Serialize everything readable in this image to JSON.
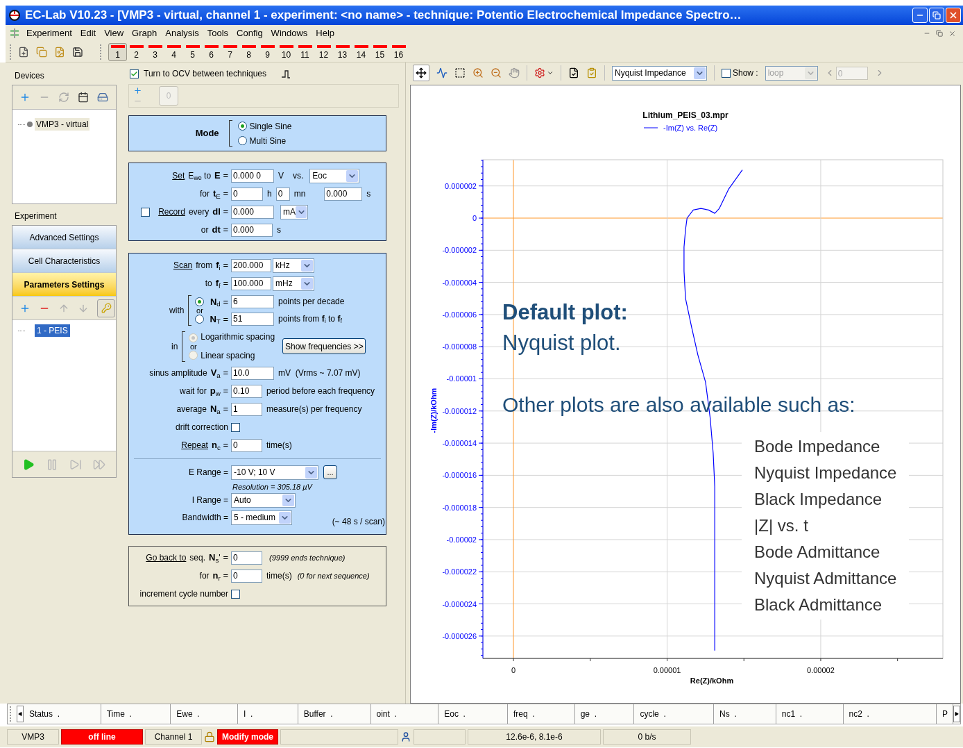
{
  "window": {
    "title": "EC-Lab V10.23 - [VMP3 - virtual, channel 1 - experiment: <no name> - technique: Potentio Electrochemical Impedance Spectro…"
  },
  "menu": [
    {
      "label": "Experiment"
    },
    {
      "label": "Edit"
    },
    {
      "label": "View"
    },
    {
      "label": "Graph"
    },
    {
      "label": "Analysis"
    },
    {
      "label": "Tools"
    },
    {
      "label": "Config"
    },
    {
      "label": "Windows"
    },
    {
      "label": "Help"
    }
  ],
  "channels": [
    {
      "label": "1",
      "selected": true
    },
    {
      "label": "2",
      "selected": false
    },
    {
      "label": "3",
      "selected": false
    },
    {
      "label": "4",
      "selected": false
    },
    {
      "label": "5",
      "selected": false
    },
    {
      "label": "6",
      "selected": false
    },
    {
      "label": "7",
      "selected": false
    },
    {
      "label": "8",
      "selected": false
    },
    {
      "label": "9",
      "selected": false
    },
    {
      "label": "10",
      "selected": false
    },
    {
      "label": "11",
      "selected": false
    },
    {
      "label": "12",
      "selected": false
    },
    {
      "label": "13",
      "selected": false
    },
    {
      "label": "14",
      "selected": false
    },
    {
      "label": "15",
      "selected": false
    },
    {
      "label": "16",
      "selected": false
    }
  ],
  "devices": {
    "title": "Devices",
    "items": [
      {
        "label": "VMP3 - virtual"
      }
    ]
  },
  "experiment": {
    "title": "Experiment",
    "sections": [
      {
        "label": "Advanced Settings",
        "selected": false
      },
      {
        "label": "Cell Characteristics",
        "selected": false
      },
      {
        "label": "Parameters Settings",
        "selected": true
      }
    ],
    "techniques": [
      {
        "label": "1 - PEIS",
        "selected": true
      }
    ]
  },
  "ocv": {
    "label": "Turn to OCV between techniques",
    "checked": true
  },
  "sequences": [
    {
      "label": "0"
    }
  ],
  "mode": {
    "label": "Mode",
    "options": [
      {
        "label": "Single Sine",
        "selected": true
      },
      {
        "label": "Multi Sine",
        "selected": false
      }
    ]
  },
  "potential": {
    "set": {
      "link": "Set",
      "label": "E$_{we}$ to",
      "symbol": "**E** =",
      "value": "0.000 0",
      "unit": "V",
      "vs": "vs.",
      "reference": "Eoc"
    },
    "duration": {
      "label": "for",
      "symbol": "**t**$_{E}$ =",
      "fields": [
        {
          "value": "0",
          "unit": "h"
        },
        {
          "value": "0",
          "unit": "mn"
        },
        {
          "value": "0.000",
          "unit": "s"
        }
      ]
    },
    "record": {
      "checked": false,
      "link": "Record",
      "label": "every",
      "symbol": "**dI** =",
      "value": "0.000",
      "unit": "mA"
    },
    "record_dt": {
      "label": "or",
      "symbol": "**dt** =",
      "value": "0.000",
      "unit": "s"
    }
  },
  "scan": {
    "from": {
      "link": "Scan",
      "label": "from",
      "symbol": "**f**$_{i}$ =",
      "value": "200.000",
      "unit": "kHz"
    },
    "to": {
      "label": "to",
      "symbol": "**f**$_{f}$ =",
      "value": "100.000",
      "unit": "mHz"
    },
    "points": {
      "label": "with",
      "or": "or",
      "options": [
        {
          "symbol": "**N**$_{d}$ =",
          "value": "6",
          "note": "points per decade",
          "selected": true
        },
        {
          "symbol": "**N**$_{T}$ =",
          "value": "51",
          "note": "points from **f**$_{i}$  to  **f**$_{f}$",
          "selected": false
        }
      ]
    },
    "spacing": {
      "label": "in",
      "or": "or",
      "disabled": true,
      "options": [
        {
          "label": "Logarithmic spacing",
          "selected": true
        },
        {
          "label": "Linear spacing",
          "selected": false
        }
      ],
      "button": "Show frequencies >>"
    },
    "rows": [
      {
        "kind": "field",
        "label": "sinus amplitude",
        "symbol": "**V**$_{a}$ =",
        "value": "10.0",
        "note": "mV  (Vrms ~ 7.07 mV)"
      },
      {
        "kind": "field",
        "label": "wait for",
        "symbol": "**p**$_{w}$ =",
        "value": "0.10",
        "note": "period before each frequency"
      },
      {
        "kind": "field",
        "label": "average",
        "symbol": "**N**$_{a}$ =",
        "value": "1",
        "note": "measure(s) per frequency"
      },
      {
        "kind": "checkbox",
        "label": "drift correction",
        "checked": false
      },
      {
        "kind": "field",
        "link": "Repeat",
        "symbol": "**n**$_{c}$ =",
        "value": "0",
        "note": "time(s)"
      }
    ],
    "e_range": {
      "label": "E Range =",
      "value": "-10 V; 10 V",
      "button": "...",
      "resolution": "Resolution = 305.18 µV"
    },
    "i_range": {
      "label": "I Range =",
      "value": "Auto"
    },
    "bandwidth": {
      "label": "Bandwidth =",
      "value": "5 - medium"
    },
    "estimate": "(~ 48 s / scan)"
  },
  "goto": {
    "link": "Go back to",
    "label": "seq.",
    "symbol": "**N**$_{s}$' =",
    "value": "0",
    "note": "(9999 ends technique)",
    "repeat": {
      "label": "for",
      "symbol": "**n**$_{r}$ =",
      "value": "0",
      "unit": "time(s)",
      "note": "(0 for next sequence)"
    },
    "increment": {
      "label": "increment cycle number",
      "checked": false
    }
  },
  "plot": {
    "selector": "Nyquist Impedance",
    "show": {
      "label": "Show :",
      "checked": false
    },
    "loop": "loop",
    "loop_index": "0",
    "chart_data": {
      "type": "line",
      "title": "Lithium_PEIS_03.mpr",
      "xlabel": "Re(Z)/kOhm",
      "ylabel": "-Im(Z)/kOhm",
      "grid": true,
      "x": [
        1.49e-05,
        1.4e-05,
        1.34e-05,
        1.31e-05,
        1.27e-05,
        1.22e-05,
        1.17e-05,
        1.13e-05,
        1.12e-05,
        1.11e-05,
        1.11e-05,
        1.12e-05,
        1.16e-05,
        1.2e-05,
        1.25e-05,
        1.28e-05,
        1.3e-05,
        1.31e-05,
        1.31e-05,
        1.31e-05,
        1.31e-05
      ],
      "series": [
        {
          "name": "-Im(Z) vs. Re(Z)",
          "color": "#0000ff",
          "values": [
            3e-06,
            1.8e-06,
            6e-07,
            3e-07,
            5e-07,
            6e-07,
            5e-07,
            0.0,
            -7e-07,
            -1.8e-06,
            -3.3e-06,
            -5e-06,
            -6.8e-06,
            -8.5e-06,
            -1.02e-05,
            -1.24e-05,
            -1.46e-05,
            -1.67e-05,
            -2.02e-05,
            -2.36e-05,
            -2.69e-05
          ]
        }
      ],
      "xlim": [
        -1.99e-06,
        2.795e-05
      ],
      "ylim": [
        -2.739e-05,
        3.63e-06
      ],
      "xticks": [
        {
          "value": 0,
          "label": "0"
        },
        {
          "value": 1e-05,
          "label": "0.00001"
        },
        {
          "value": 2e-05,
          "label": "0.00002"
        }
      ],
      "yticks": [
        {
          "value": 2e-06,
          "label": "0.000002"
        },
        {
          "value": 0,
          "label": "0"
        },
        {
          "value": -2e-06,
          "label": "-0.000002"
        },
        {
          "value": -4e-06,
          "label": "-0.000004"
        },
        {
          "value": -6e-06,
          "label": "-0.000006"
        },
        {
          "value": -8e-06,
          "label": "-0.000008"
        },
        {
          "value": -1e-05,
          "label": "-0.00001"
        },
        {
          "value": -1.2e-05,
          "label": "-0.000012"
        },
        {
          "value": -1.4e-05,
          "label": "-0.000014"
        },
        {
          "value": -1.6e-05,
          "label": "-0.000016"
        },
        {
          "value": -1.8e-05,
          "label": "-0.000018"
        },
        {
          "value": -2e-05,
          "label": "-0.00002"
        },
        {
          "value": -2.2e-05,
          "label": "-0.000022"
        },
        {
          "value": -2.4e-05,
          "label": "-0.000024"
        },
        {
          "value": -2.6e-05,
          "label": "-0.000026"
        }
      ]
    },
    "callout": {
      "title": "Default plot:",
      "subtitle": "Nyquist plot.",
      "intro": "Other plots are also available such as:",
      "items": [
        "Bode Impedance",
        "Nyquist Impedance",
        "Black Impedance",
        "|Z| vs. t",
        "Bode Admittance",
        "Nyquist Admittance",
        "Black Admittance"
      ]
    }
  },
  "columns": [
    "Status  .",
    "Time  .",
    "Ewe  .",
    "I  .",
    "Buffer  .",
    "oint  .",
    "Eoc  .",
    "freq  .",
    "ge  .",
    "cycle  .",
    "Ns  .",
    "nc1  .",
    "nc2  .",
    "P"
  ],
  "status_bar": [
    {
      "text": "VMP3",
      "alert": false
    },
    {
      "text": "off line",
      "alert": true
    },
    {
      "text": "Channel 1",
      "alert": false
    },
    {
      "text": "Modify mode",
      "alert": true
    },
    {
      "text": "12.6e-6, 8.1e-6",
      "alert": false
    },
    {
      "text": "0 b/s",
      "alert": false
    }
  ]
}
